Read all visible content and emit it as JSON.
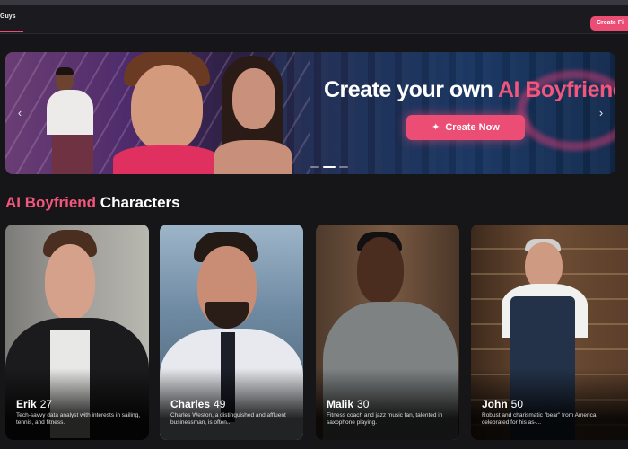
{
  "nav": {
    "tab_label": "Guys",
    "create_button": "Create Fi"
  },
  "banner": {
    "title_prefix": "Create your own ",
    "title_accent": "AI Boyfriend",
    "cta_label": "Create Now",
    "cta_icon": "magic-wand-icon",
    "prev_icon": "chevron-left-icon",
    "next_icon": "chevron-right-icon"
  },
  "section": {
    "title_accent": "AI Boyfriend",
    "title_rest": " Characters"
  },
  "characters": [
    {
      "name": "Erik",
      "age": "27",
      "description": "Tech-savvy data analyst with interests in sailing, tennis, and fitness."
    },
    {
      "name": "Charles",
      "age": "49",
      "description": "Charles Weston, a distinguished and affluent businessman, is often..."
    },
    {
      "name": "Malik",
      "age": "30",
      "description": "Fitness coach and jazz music fan, talented in saxophone playing."
    },
    {
      "name": "John",
      "age": "50",
      "description": "Robust and charismatic \"bear\" from America, celebrated for his as-..."
    }
  ],
  "colors": {
    "background": "#161518",
    "accent": "#ec4d75",
    "accent_text": "#f2567c"
  }
}
